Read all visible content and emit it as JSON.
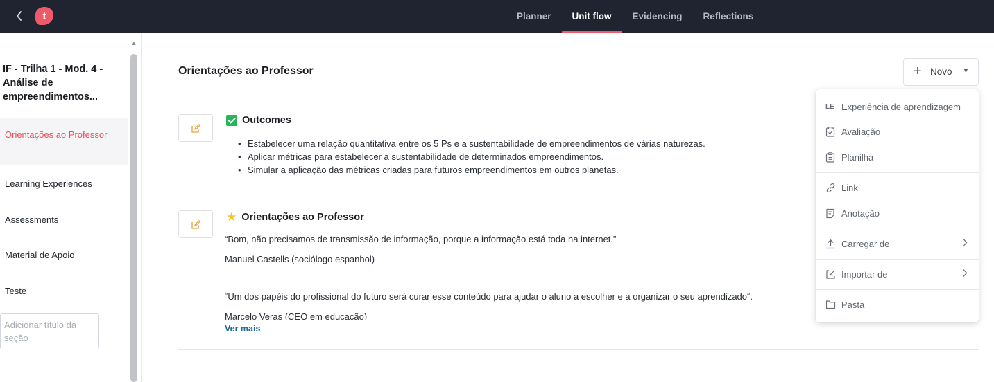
{
  "topbar": {
    "back_icon": "chevron-left-icon",
    "logo_letter": "t",
    "logo_color": "#ef5a6a",
    "tabs": [
      {
        "label": "Planner"
      },
      {
        "label": "Unit flow"
      },
      {
        "label": "Evidencing"
      },
      {
        "label": "Reflections"
      }
    ],
    "active_tab": "Unit flow"
  },
  "sidebar": {
    "unit_title": "IF - Trilha 1 - Mod. 4 - Análise de empreendimentos...",
    "items": [
      {
        "label": "Orientações ao Professor"
      },
      {
        "label": "Learning Experiences"
      },
      {
        "label": "Assessments"
      },
      {
        "label": "Material de Apoio"
      },
      {
        "label": "Teste"
      }
    ],
    "add_section_placeholder": "Adicionar título da seção"
  },
  "main": {
    "title": "Orientações ao Professor",
    "new_button": {
      "label": "Novo"
    },
    "outcomes_block": {
      "title": "Outcomes",
      "items": [
        "Estabelecer uma relação quantitativa entre os 5 Ps e a sustentabilidade de empreendimentos de várias naturezas.",
        "Aplicar métricas para estabelecer a sustentabilidade de determinados empreendimentos.",
        "Simular a aplicação das métricas criadas para futuros empreendimentos em outros planetas."
      ]
    },
    "guidance_block": {
      "title": "Orientações ao Professor",
      "quote1": "“Bom, não precisamos de transmissão de informação, porque a informação está toda na internet.”",
      "author1": "Manuel Castells (sociólogo espanhol)",
      "quote2": "“Um dos papéis do profissional do futuro será curar esse conteúdo para ajudar o aluno a escolher e a organizar o seu aprendizado“.",
      "author2": "Marcelo Veras (CEO em educação)",
      "see_more": "Ver mais"
    }
  },
  "menu": {
    "items": [
      {
        "icon": "LE",
        "label": "Experiência de aprendizagem"
      },
      {
        "icon": "clipboard-check-icon",
        "label": "Avaliação"
      },
      {
        "icon": "clipboard-list-icon",
        "label": "Planilha"
      },
      {
        "icon": "link-icon",
        "label": "Link"
      },
      {
        "icon": "note-icon",
        "label": "Anotação"
      },
      {
        "icon": "upload-icon",
        "label": "Carregar de"
      },
      {
        "icon": "import-icon",
        "label": "Importar de"
      },
      {
        "icon": "folder-icon",
        "label": "Pasta"
      }
    ]
  }
}
